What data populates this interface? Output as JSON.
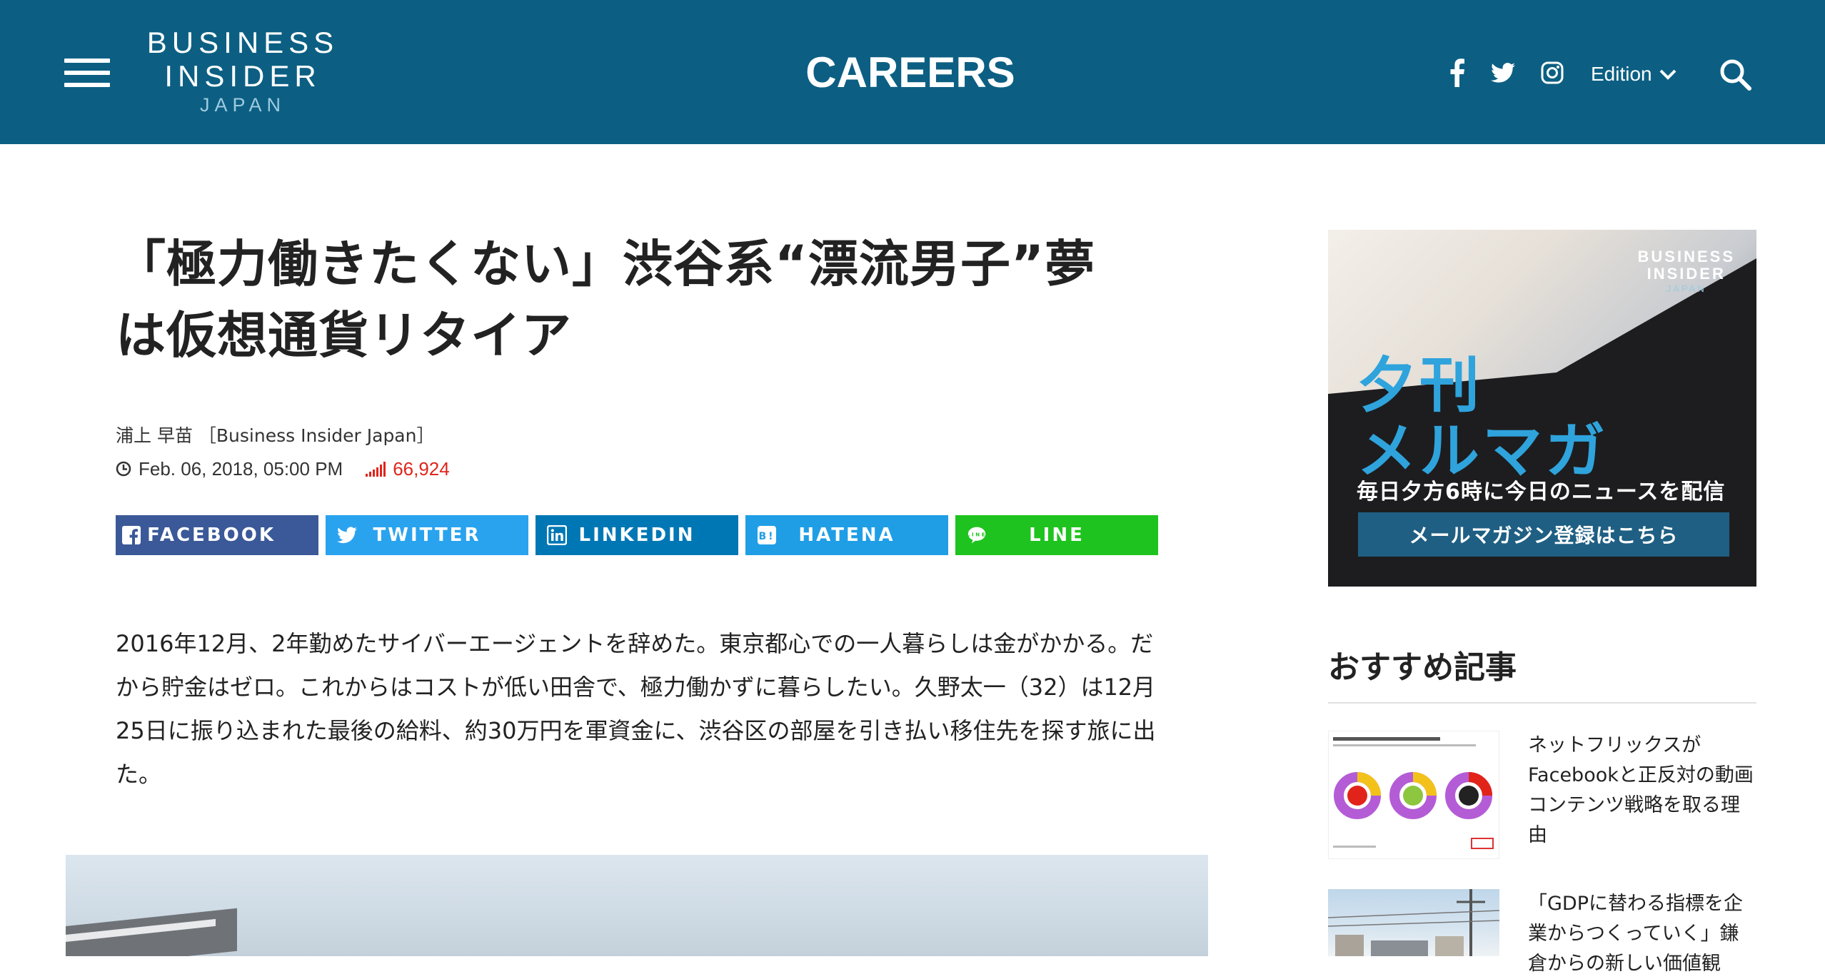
{
  "header": {
    "logo": {
      "line1": "BUSINESS",
      "line2": "INSIDER",
      "line3": "JAPAN"
    },
    "section_title": "CAREERS",
    "edition_label": "Edition",
    "colors": {
      "bar": "#0c5f83"
    }
  },
  "article": {
    "headline": "「極力働きたくない」渋谷系“漂流男子”夢は仮想通貨リタイア",
    "byline": "浦上 早苗 ［Business Insider Japan］",
    "date": "Feb. 06, 2018, 05:00 PM",
    "views": "66,924",
    "share_buttons": [
      {
        "label": "FACEBOOK",
        "icon": "facebook-icon",
        "color": "#3b5998"
      },
      {
        "label": "TWITTER",
        "icon": "twitter-icon",
        "color": "#2aa3ef"
      },
      {
        "label": "LINKEDIN",
        "icon": "linkedin-icon",
        "color": "#0077b5"
      },
      {
        "label": "HATENA",
        "icon": "hatena-icon",
        "color": "#1f9ee6"
      },
      {
        "label": "LINE",
        "icon": "line-icon",
        "color": "#1fc31f"
      }
    ],
    "body": "2016年12月、2年勤めたサイバーエージェントを辞めた。東京都心での一人暮らしは金がかかる。だから貯金はゼロ。これからはコストが低い田舎で、極力働かずに暮らしたい。久野太一（32）は12月25日に振り込まれた最後の給料、約30万円を軍資金に、渋谷区の部屋を引き払い移住先を探す旅に出た。"
  },
  "sidebar": {
    "ad": {
      "logo": {
        "line1": "BUSINESS",
        "line2": "INSIDER",
        "line3": "JAPAN"
      },
      "title_line1": "夕刊",
      "title_line2": "メルマガ",
      "subtitle": "毎日夕方6時に今日のニュースを配信",
      "button_label": "メールマガジン登録はこちら"
    },
    "recommended_heading": "おすすめ記事",
    "recommended": [
      {
        "title": "ネットフリックスがFacebookと正反対の動画コンテンツ戦略を取る理由"
      },
      {
        "title": "「GDPに替わる指標を企業からつくっていく」鎌倉からの新しい価値観"
      }
    ]
  }
}
